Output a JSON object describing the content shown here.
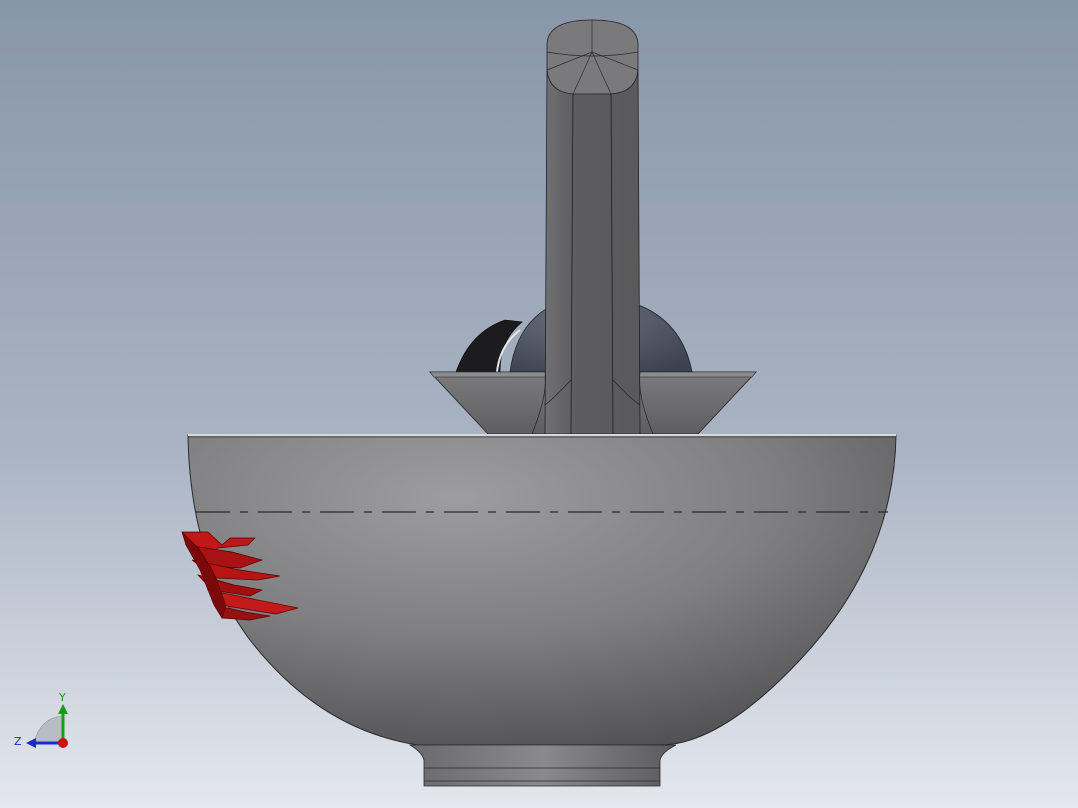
{
  "viewport": {
    "background_top": "#8896aa",
    "background_bottom": "#e4e7ee"
  },
  "model": {
    "bowl_color": "#8a8a8c",
    "spout_color": "#6a6a6c",
    "dome_color": "#5a5e6c",
    "handle_color": "#1c1c1e",
    "red_part_color": "#b01010"
  },
  "triad": {
    "y_label": "Y",
    "z_label": "Z",
    "x_color": "#cc1111",
    "y_color": "#1a9a1a",
    "z_color": "#1a2ad0"
  }
}
